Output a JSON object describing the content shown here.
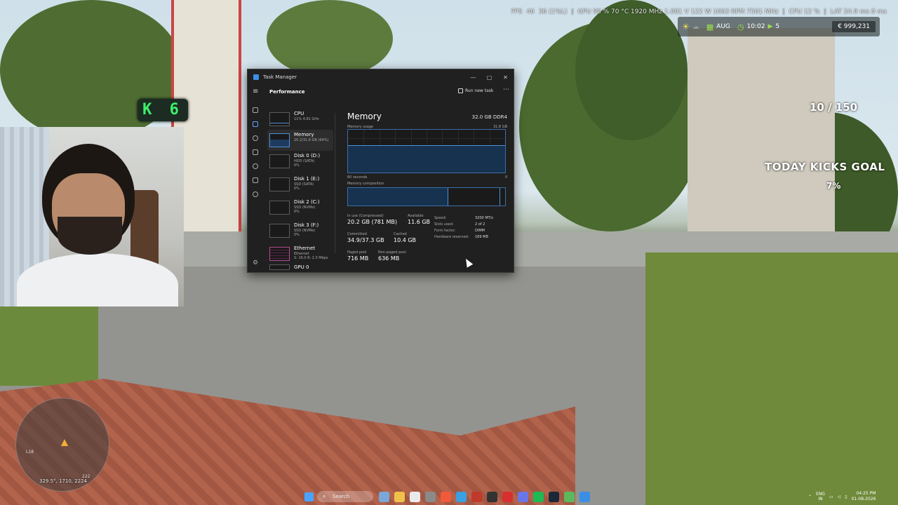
{
  "hud": {
    "fps_label": "FPS",
    "fps_value": "46",
    "fps_low": "36 (1%L)",
    "gpu_stats": "GPU 98 % 70 °C 1920 MHz 1.081 V 122 W 1063 RPM 7501 MHz",
    "cpu_stats": "CPU 12 %",
    "lat_stats": "LAT 24.9 ms 0 ms",
    "month": "AUG",
    "time": "10:02",
    "speed": "5",
    "money": "€ 999,231",
    "ko_badge": "K 6",
    "counter": "10 / 150",
    "goal_title": "TODAY KICKS GOAL",
    "goal_pct": "7%",
    "coords": "329.5°, 1710, 2224",
    "minimap_n1": "L18",
    "minimap_n2": "222"
  },
  "task_manager": {
    "window_title": "Task Manager",
    "section": "Performance",
    "run_new_task": "Run new task",
    "devices": [
      {
        "name": "CPU",
        "sub": "11% 4.81 GHz",
        "sub2": ""
      },
      {
        "name": "Memory",
        "sub": "20.2/31.8 GB (64%)",
        "sub2": ""
      },
      {
        "name": "Disk 0 (D:)",
        "sub": "HDD (SATA)",
        "sub2": "0%"
      },
      {
        "name": "Disk 1 (E:)",
        "sub": "SSD (SATA)",
        "sub2": "0%"
      },
      {
        "name": "Disk 2 (C:)",
        "sub": "SSD (NVMe)",
        "sub2": "0%"
      },
      {
        "name": "Disk 3 (F:)",
        "sub": "SSD (NVMe)",
        "sub2": "0%"
      },
      {
        "name": "Ethernet",
        "sub": "Ethernet",
        "sub2": "S: 16.0 R: 2.3 Mbps"
      },
      {
        "name": "GPU 0",
        "sub": "",
        "sub2": ""
      }
    ],
    "memory": {
      "title": "Memory",
      "total": "32.0 GB DDR4",
      "usage_label": "Memory usage",
      "usage_max": "31.8 GB",
      "usage_fraction": 0.64,
      "seconds_label": "60 seconds",
      "zero_label": "0",
      "composition_label": "Memory composition",
      "inuse_fraction": 0.64,
      "cached_fraction": 0.33,
      "in_use_label": "In use (Compressed)",
      "in_use_value": "20.2 GB (781 MB)",
      "available_label": "Available",
      "available_value": "11.6 GB",
      "committed_label": "Committed",
      "committed_value": "34.9/37.3 GB",
      "cached_label": "Cached",
      "cached_value": "10.4 GB",
      "paged_label": "Paged pool",
      "paged_value": "716 MB",
      "nonpaged_label": "Non-paged pool",
      "nonpaged_value": "636 MB",
      "props": [
        {
          "key": "Speed:",
          "value": "3200 MT/s"
        },
        {
          "key": "Slots used:",
          "value": "2 of 2"
        },
        {
          "key": "Form factor:",
          "value": "DIMM"
        },
        {
          "key": "Hardware reserved:",
          "value": "169 MB"
        }
      ]
    }
  },
  "taskbar": {
    "search_placeholder": "Search",
    "lang": "ENG",
    "region": "IN",
    "time": "04:25 PM",
    "date": "01-08-2026"
  },
  "colors": {
    "accent": "#4d8fda",
    "ko_green": "#3ef06a",
    "ethernet": "#b14b8e"
  }
}
